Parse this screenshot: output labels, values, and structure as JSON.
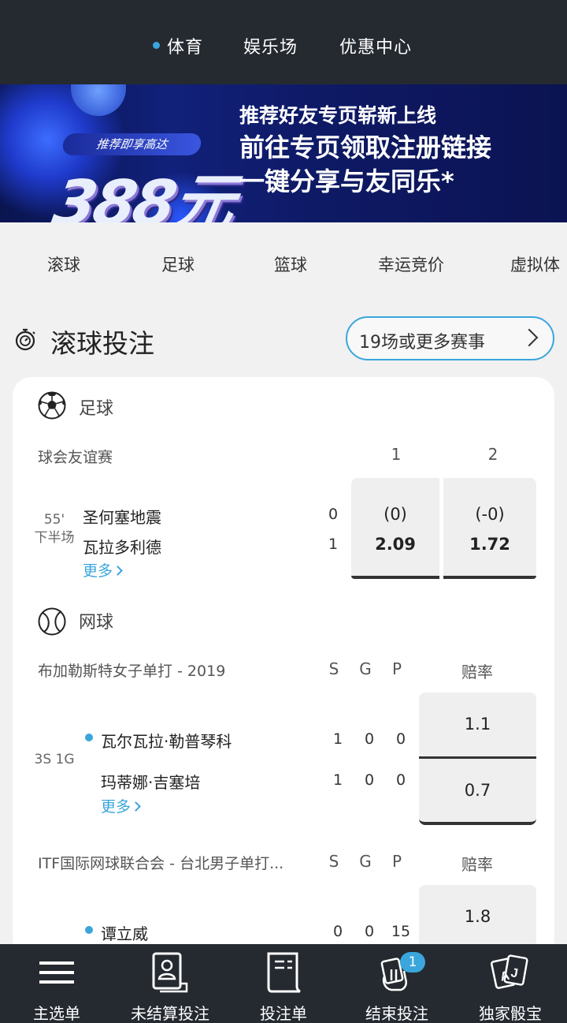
{
  "topnav": {
    "tabs": [
      {
        "label": "体育",
        "active": true
      },
      {
        "label": "娱乐场",
        "active": false
      },
      {
        "label": "优惠中心",
        "active": false
      }
    ]
  },
  "banner": {
    "pill": "推荐即享高达",
    "amount": "388元",
    "line1": "推荐好友专页崭新上线",
    "line2": "前往专页领取注册链接",
    "line3": "一键分享与友同乐*"
  },
  "sport_tabs": [
    "滚球",
    "足球",
    "篮球",
    "幸运竞价",
    "虚拟体"
  ],
  "live": {
    "title": "滚球投注",
    "more_button": "19场或更多赛事"
  },
  "football": {
    "header": "足球",
    "league": "球会友谊赛",
    "col1": "1",
    "col2": "2",
    "time_min": "55'",
    "time_half": "下半场",
    "team1": "圣何塞地震",
    "team2": "瓦拉多利德",
    "score1": "0",
    "score2": "1",
    "more": "更多",
    "odds1_hcp": "(0)",
    "odds1_val": "2.09",
    "odds2_hcp": "(-0)",
    "odds2_val": "1.72"
  },
  "tennis": {
    "header": "网球",
    "match1": {
      "league": "布加勒斯特女子单打 - 2019",
      "cols": [
        "S",
        "G",
        "P"
      ],
      "odds_label": "赔率",
      "state": "3S 1G",
      "p1": "瓦尔瓦拉·勒普琴科",
      "p2": "玛蒂娜·吉塞培",
      "p1_scores": [
        "1",
        "0",
        "0"
      ],
      "p2_scores": [
        "1",
        "0",
        "0"
      ],
      "more": "更多",
      "odd1": "1.1",
      "odd2": "0.7"
    },
    "match2": {
      "league": "ITF国际网球联合会 - 台北男子单打...",
      "cols": [
        "S",
        "G",
        "P"
      ],
      "odds_label": "赔率",
      "p1": "谭立威",
      "p1_scores": [
        "0",
        "0",
        "15"
      ],
      "odd1": "1.8"
    }
  },
  "bottomnav": {
    "items": [
      {
        "label": "主选单",
        "icon": "menu-icon"
      },
      {
        "label": "未结算投注",
        "icon": "bet-slip-person-icon"
      },
      {
        "label": "投注单",
        "icon": "betslip-icon"
      },
      {
        "label": "结束投注",
        "icon": "cashout-hand-icon",
        "badge": "1"
      },
      {
        "label": "独家骰宝",
        "icon": "cards-icon"
      }
    ]
  },
  "colors": {
    "accent": "#3aa6dc",
    "nav_bg": "#252a31"
  }
}
